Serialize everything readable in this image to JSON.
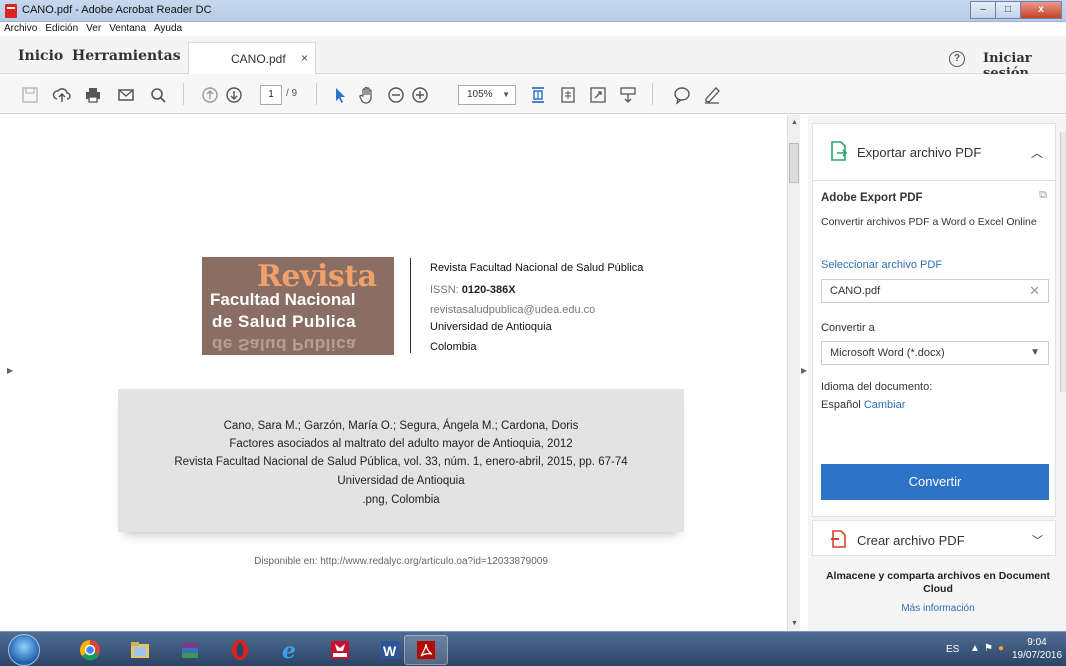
{
  "window": {
    "title": "CANO.pdf - Adobe Acrobat Reader DC",
    "minimize": "–",
    "maximize": "□",
    "close": "x"
  },
  "menu": [
    "Archivo",
    "Edición",
    "Ver",
    "Ventana",
    "Ayuda"
  ],
  "tabs": {
    "home": "Inicio",
    "tools": "Herramientas",
    "document": "CANO.pdf",
    "close": "×"
  },
  "header": {
    "help": "?",
    "signin": "Iniciar sesión"
  },
  "toolbar": {
    "page_current": "1",
    "page_total": "/ 9",
    "zoom": "105%"
  },
  "document": {
    "logo": {
      "line1": "Revista",
      "line2": "Facultad Nacional",
      "line3": "de Salud Publica"
    },
    "journal_info": {
      "name": "Revista Facultad Nacional de Salud Pública",
      "issn_label": "ISSN:",
      "issn_value": "0120-386X",
      "email": "revistasaludpublica@udea.edu.co",
      "university": "Universidad de Antioquia",
      "country": "Colombia"
    },
    "citation": [
      "Cano, Sara M.; Garzón, María O.; Segura, Ángela M.; Cardona, Doris",
      "Factores asociados al maltrato del adulto mayor de Antioquia, 2012",
      "Revista Facultad Nacional de Salud Pública, vol. 33, núm. 1, enero-abril, 2015, pp. 67-74",
      "Universidad de Antioquia",
      ".png, Colombia"
    ],
    "available": "Disponible en: http://www.redalyc.org/articulo.oa?id=12033879009"
  },
  "right_panel": {
    "export_title": "Exportar archivo PDF",
    "service_name": "Adobe Export PDF",
    "service_desc": "Convertir archivos PDF a Word o Excel Online",
    "select_file_label": "Seleccionar archivo PDF",
    "selected_file": "CANO.pdf",
    "convert_to_label": "Convertir a",
    "convert_format": "Microsoft Word (*.docx)",
    "doc_language_label": "Idioma del documento:",
    "doc_language": "Español",
    "change_link": "Cambiar",
    "convert_button": "Convertir",
    "create_title": "Crear archivo PDF",
    "store_text": "Almacene y comparta archivos en Document Cloud",
    "more_info": "Más información"
  },
  "taskbar": {
    "language": "ES",
    "time": "9:04",
    "date": "19/07/2016"
  },
  "colors": {
    "accent_blue": "#2d73c7",
    "export_green": "#2aa86b",
    "create_red": "#d9412f",
    "logo_brown": "#8a6e63",
    "logo_orange": "#f0a06a"
  }
}
